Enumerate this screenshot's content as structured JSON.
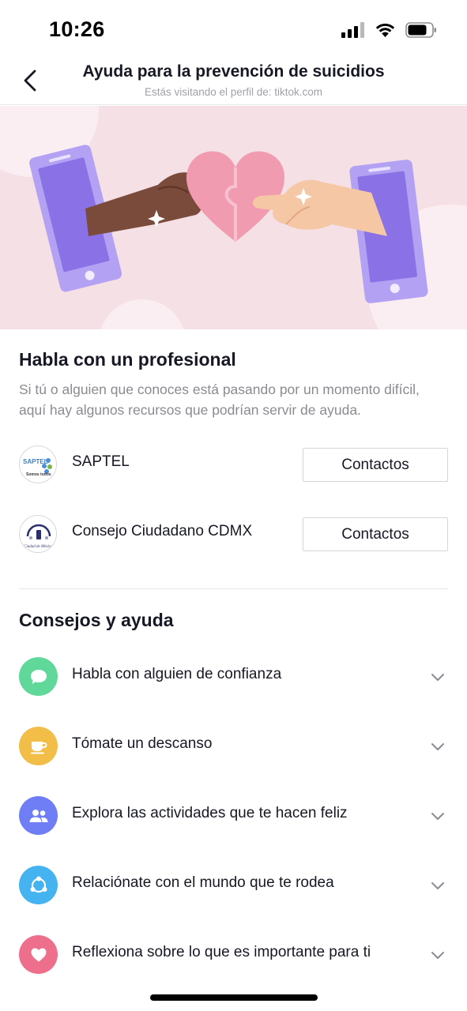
{
  "status": {
    "time": "10:26"
  },
  "header": {
    "title": "Ayuda para la prevención de suicidios",
    "subtitle": "Estás visitando el perfil de: tiktok.com"
  },
  "professional": {
    "title": "Habla con un profesional",
    "description": "Si tú o alguien que conoces está pasando por un momento difícil, aquí hay algunos recursos que podrían servir de ayuda.",
    "resources": [
      {
        "name": "SAPTEL",
        "logo_text": "SAPTEL",
        "logo_caption": "Somos todos",
        "button": "Contactos"
      },
      {
        "name": "Consejo Ciudadano CDMX",
        "logo_text": "Ciudad de México",
        "button": "Contactos"
      }
    ]
  },
  "tips": {
    "title": "Consejos y ayuda",
    "items": [
      {
        "label": "Habla con alguien de confianza",
        "icon": "chat-bubble-icon",
        "color": "#5fd899"
      },
      {
        "label": "Tómate un descanso",
        "icon": "coffee-cup-icon",
        "color": "#f2be47"
      },
      {
        "label": "Explora las actividades que te hacen feliz",
        "icon": "people-icon",
        "color": "#6f7ef5"
      },
      {
        "label": "Relaciónate con el mundo que te rodea",
        "icon": "network-icon",
        "color": "#45b3ef"
      },
      {
        "label": "Reflexiona sobre lo que es importante para ti",
        "icon": "heart-icon",
        "color": "#ee6f8c"
      }
    ]
  }
}
